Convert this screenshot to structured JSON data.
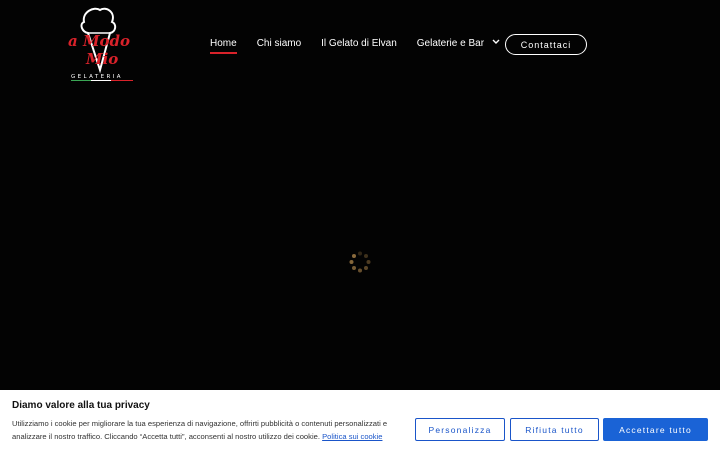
{
  "header": {
    "logo": {
      "line1": "a Modo",
      "line2": "Mio",
      "tagline": "GELATERIA",
      "icon": "ice-cream-cone-icon"
    },
    "nav": [
      {
        "label": "Home",
        "active": true
      },
      {
        "label": "Chi siamo",
        "active": false
      },
      {
        "label": "Il Gelato di Elvan",
        "active": false
      },
      {
        "label": "Gelaterie e Bar",
        "active": false,
        "has_dropdown": true,
        "icon": "chevron-down-icon"
      }
    ],
    "contact_label": "Contattaci"
  },
  "loader": {
    "icon": "loading-spinner-icon",
    "color": "#8a6a3c"
  },
  "cookie_banner": {
    "title": "Diamo valore alla tua privacy",
    "text": "Utilizziamo i cookie per migliorare la tua esperienza di navigazione, offrirti pubblicità o contenuti personalizzati e analizzare il nostro traffico. Cliccando “Accetta tutti”, acconsenti al nostro utilizzo dei cookie.",
    "policy_link": "Politica sui cookie",
    "buttons": {
      "customize": "Personalizza",
      "reject": "Rifiuta tutto",
      "accept": "Accettare tutto"
    }
  },
  "colors": {
    "background": "#030303",
    "accent_red": "#d9222a",
    "button_blue": "#1a63d6"
  }
}
